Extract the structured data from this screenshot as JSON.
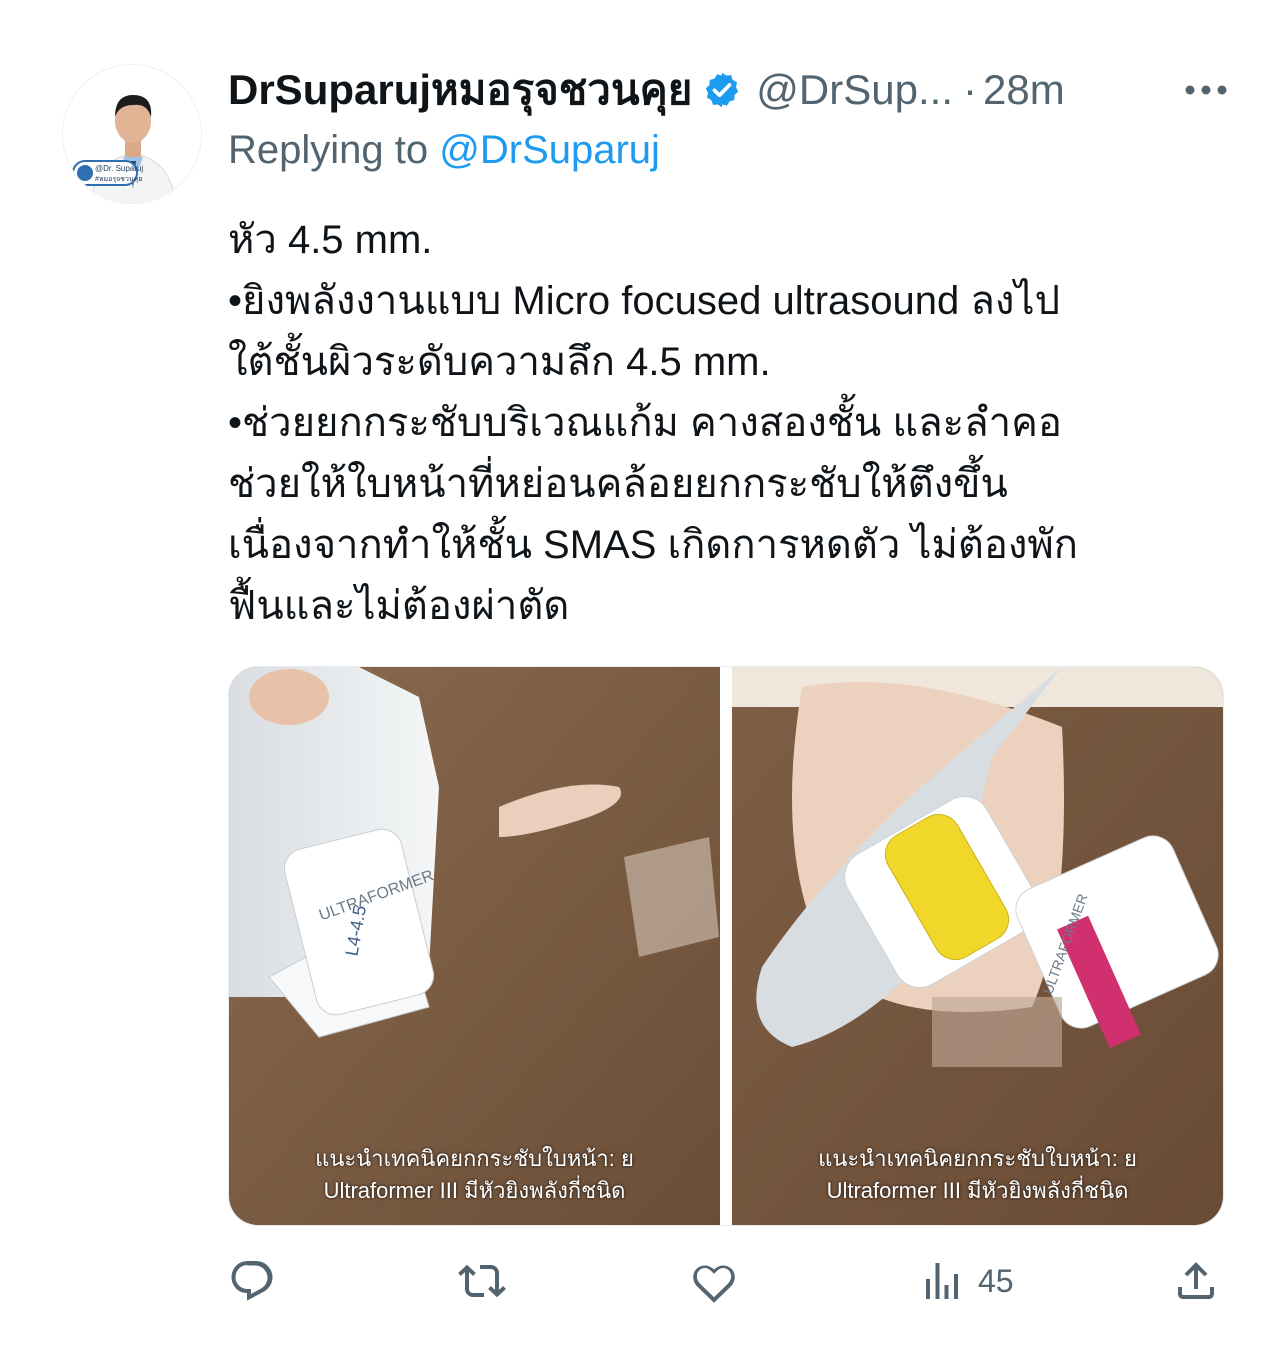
{
  "tweet": {
    "display_name": "DrSuparujหมอรุจชวนคุย",
    "handle": "@DrSup...",
    "separator": "·",
    "time": "28m",
    "reply_prefix": "Replying to",
    "reply_handle": "@DrSuparuj",
    "text_lines": [
      "หัว 4.5 mm.",
      "•ยิงพลังงานแบบ Micro focused ultrasound ลงไป",
      "ใต้ชั้นผิวระดับความลึก 4.5 mm.",
      "•ช่วยยกกระชับบริเวณแก้ม คางสองชั้น และลำคอ",
      "ช่วยให้ใบหน้าที่หย่อนคล้อยยกกระชับให้ตึงขึ้น",
      "เนื่องจากทำให้ชั้น SMAS เกิดการหดตัว ไม่ต้องพัก",
      "ฟื้นและไม่ต้องผ่าตัด"
    ]
  },
  "avatar": {
    "badge_line1": "@Dr. Suparuj",
    "badge_line2": "#หมอรุจชวนคุย"
  },
  "media": {
    "left": {
      "caption_line1": "แนะนำเทคนิคยกกระชับใบหน้า: ย",
      "caption_line2": "Ultraformer III มีหัวยิงพลังกี่ชนิด",
      "device_brand": "ULTRAFORMER",
      "cartridge_label": "L4-4.5"
    },
    "right": {
      "caption_line1": "แนะนำเทคนิคยกกระชับใบหน้า: ย",
      "caption_line2": "Ultraformer III มีหัวยิงพลังกี่ชนิด",
      "device_brand": "ULTRAFORMER"
    }
  },
  "actions": {
    "reply_icon": "reply-icon",
    "retweet_icon": "retweet-icon",
    "like_icon": "heart-icon",
    "views_icon": "views-icon",
    "views_count": "45",
    "share_icon": "share-icon"
  },
  "colors": {
    "text_primary": "#0f1419",
    "text_secondary": "#536471",
    "accent": "#1d9bf0"
  }
}
